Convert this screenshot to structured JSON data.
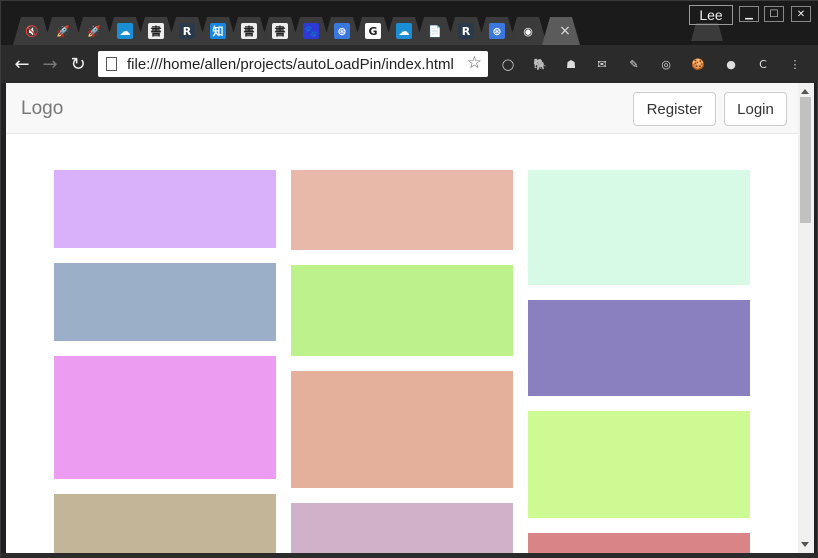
{
  "browser": {
    "profile_name": "Lee",
    "tabs": [
      {
        "icon": "mute-icon",
        "glyph": "🔇",
        "color": "#3b3b3b"
      },
      {
        "icon": "rocket-icon",
        "glyph": "🚀",
        "color": "#3b3b3b"
      },
      {
        "icon": "rocket-icon",
        "glyph": "🚀",
        "color": "#3b3b3b"
      },
      {
        "icon": "cloud-icon",
        "glyph": "☁",
        "color": "#1a8fd6"
      },
      {
        "icon": "calligraphy-icon",
        "glyph": "書",
        "color": "#eeeeee"
      },
      {
        "icon": "r-icon",
        "glyph": "R",
        "color": "#2a3a4a"
      },
      {
        "icon": "zhi-icon",
        "glyph": "知",
        "color": "#1787e3"
      },
      {
        "icon": "calligraphy-icon",
        "glyph": "書",
        "color": "#eeeeee"
      },
      {
        "icon": "calligraphy-icon",
        "glyph": "書",
        "color": "#eeeeee"
      },
      {
        "icon": "paw-icon",
        "glyph": "🐾",
        "color": "#2d3bd4"
      },
      {
        "icon": "translate-icon",
        "glyph": "⊛",
        "color": "#3a78e0"
      },
      {
        "icon": "google-icon",
        "glyph": "G",
        "color": "#ffffff"
      },
      {
        "icon": "cloud-icon",
        "glyph": "☁",
        "color": "#1a8fd6"
      },
      {
        "icon": "file-icon",
        "glyph": "📄",
        "color": "#3b3b3b"
      },
      {
        "icon": "r-icon",
        "glyph": "R",
        "color": "#2a3a4a"
      },
      {
        "icon": "translate-icon",
        "glyph": "⊛",
        "color": "#3a78e0"
      },
      {
        "icon": "github-icon",
        "glyph": "◉",
        "color": "#3b3b3b"
      }
    ],
    "active_tab_close": "×",
    "url": "file:///home/allen/projects/autoLoadPin/index.html",
    "extensions": [
      {
        "icon": "circle-ext-icon",
        "glyph": "◯"
      },
      {
        "icon": "elephant-ext-icon",
        "glyph": "🐘"
      },
      {
        "icon": "ninja-ext-icon",
        "glyph": "☗"
      },
      {
        "icon": "mail-ext-icon",
        "glyph": "✉"
      },
      {
        "icon": "pen-ext-icon",
        "glyph": "✎"
      },
      {
        "icon": "color-wheel-ext-icon",
        "glyph": "◎"
      },
      {
        "icon": "cookie-ext-icon",
        "glyph": "🍪"
      },
      {
        "icon": "palette-ext-icon",
        "glyph": "●"
      },
      {
        "icon": "c-ext-icon",
        "glyph": "C"
      },
      {
        "icon": "menu-icon",
        "glyph": "⋮"
      }
    ]
  },
  "page": {
    "brand": "Logo",
    "register_label": "Register",
    "login_label": "Login",
    "pins": [
      {
        "column": 0,
        "color": "#d9b0fa"
      },
      {
        "column": 0,
        "color": "#9cafc9"
      },
      {
        "column": 0,
        "color": "#ec9cf1"
      },
      {
        "column": 0,
        "color": "#c3b597"
      },
      {
        "column": 1,
        "color": "#e8b8a8"
      },
      {
        "column": 1,
        "color": "#bcf18c"
      },
      {
        "column": 1,
        "color": "#e5b09b"
      },
      {
        "column": 1,
        "color": "#cfb2c9"
      },
      {
        "column": 2,
        "color": "#d7fae6"
      },
      {
        "column": 2,
        "color": "#8a80bf"
      },
      {
        "column": 2,
        "color": "#cefa94"
      },
      {
        "column": 2,
        "color": "#d98585"
      }
    ]
  }
}
